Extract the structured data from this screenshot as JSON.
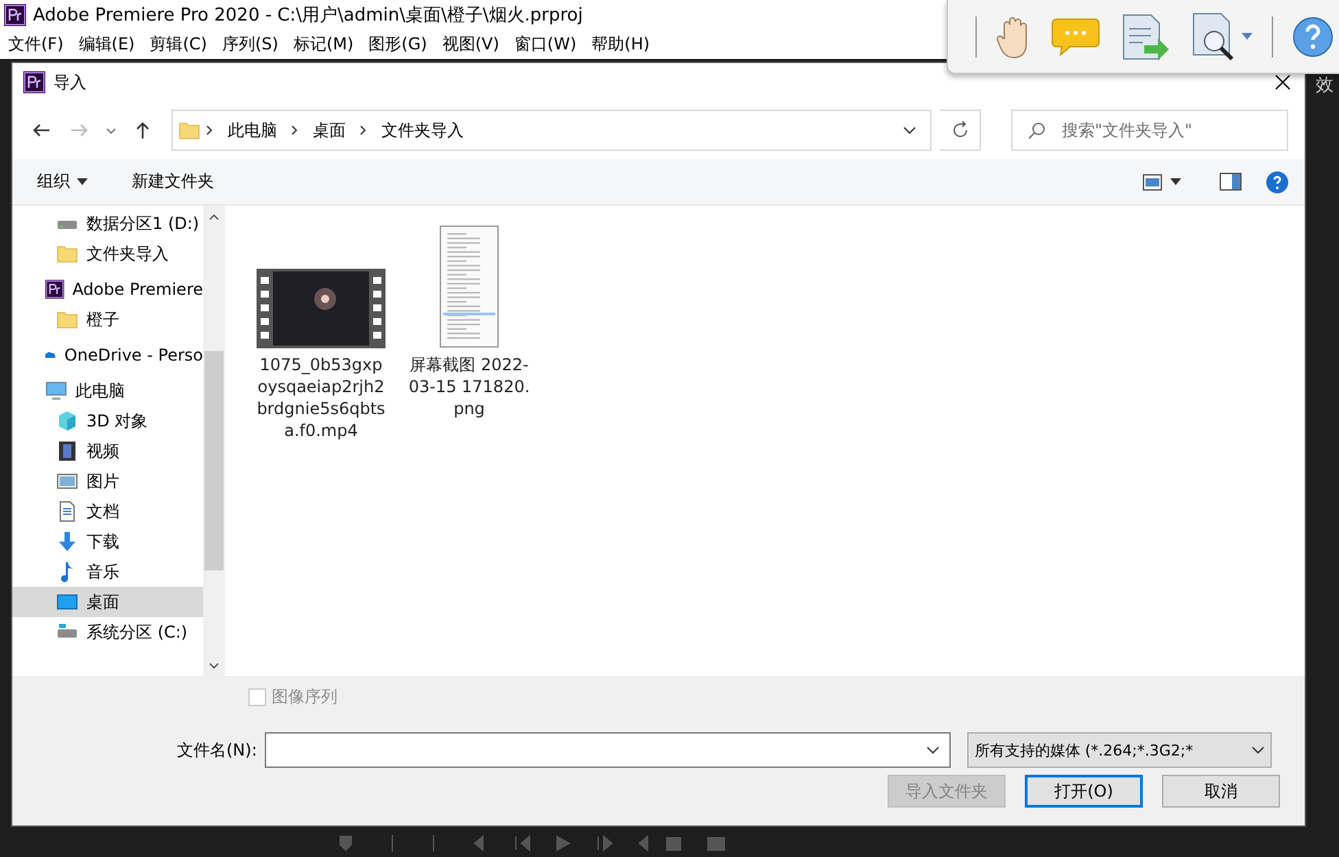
{
  "app": {
    "title": "Adobe Premiere Pro 2020 - C:\\用户\\admin\\桌面\\橙子\\烟火.prproj",
    "menu": [
      "文件(F)",
      "编辑(E)",
      "剪辑(C)",
      "序列(S)",
      "标记(M)",
      "图形(G)",
      "视图(V)",
      "窗口(W)",
      "帮助(H)"
    ],
    "side_panel_text": "效"
  },
  "dialog": {
    "title": "导入",
    "breadcrumb": [
      "此电脑",
      "桌面",
      "文件夹导入"
    ],
    "search": {
      "placeholder": "搜索\"文件夹导入\""
    },
    "toolbar": {
      "organize": "组织",
      "new_folder": "新建文件夹"
    },
    "sidebar": {
      "quick_access": [
        {
          "label": "数据分区1 (D:)",
          "kind": "drive",
          "selected": false
        },
        {
          "label": "文件夹导入",
          "kind": "folder",
          "selected": false
        }
      ],
      "items": [
        {
          "label": "Adobe Premiere",
          "kind": "premiere",
          "selected": false,
          "children": [
            {
              "label": "橙子",
              "kind": "folder",
              "selected": false
            }
          ]
        },
        {
          "label": "OneDrive - Perso",
          "kind": "onedrive",
          "selected": false
        },
        {
          "label": "此电脑",
          "kind": "pc",
          "selected": false,
          "children": [
            {
              "label": "3D 对象",
              "kind": "cube",
              "selected": false
            },
            {
              "label": "视频",
              "kind": "video",
              "selected": false
            },
            {
              "label": "图片",
              "kind": "pictures",
              "selected": false
            },
            {
              "label": "文档",
              "kind": "document",
              "selected": false
            },
            {
              "label": "下载",
              "kind": "download",
              "selected": false
            },
            {
              "label": "音乐",
              "kind": "music",
              "selected": false
            },
            {
              "label": "桌面",
              "kind": "desktop",
              "selected": true
            },
            {
              "label": "系统分区 (C:)",
              "kind": "system",
              "selected": false
            }
          ]
        }
      ]
    },
    "files": [
      {
        "name": "1075_0b53gxpoysqaeiap2rjh2brdgnie5s6qbtsa.f0.mp4",
        "kind": "video"
      },
      {
        "name": "屏幕截图 2022-03-15 171820.png",
        "kind": "image"
      }
    ],
    "image_sequence": {
      "label": "图像序列",
      "checked": false,
      "disabled": true
    },
    "filename": {
      "label": "文件名(N):"
    },
    "filter": "所有支持的媒体 (*.264;*.3G2;*",
    "buttons": [
      {
        "label": "导入文件夹",
        "disabled": true,
        "default": false
      },
      {
        "label": "打开(O)",
        "disabled": false,
        "default": true
      },
      {
        "label": "取消",
        "disabled": false,
        "default": false
      }
    ]
  }
}
